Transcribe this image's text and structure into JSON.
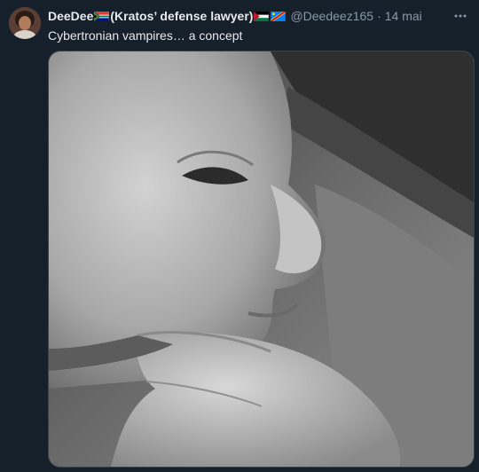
{
  "tweet": {
    "display_name_prefix": "DeeDee",
    "display_name_main": "(Kratos’ defense lawyer)",
    "handle": "@Deedeez165",
    "separator": "·",
    "date": "14 mai",
    "text": "Cybertronian vampires… a concept",
    "more_icon": "ellipsis-icon",
    "avatar_icon": "avatar",
    "flags": [
      "south-africa-flag-icon",
      "palestine-flag-icon",
      "congo-flag-icon"
    ]
  },
  "media": {
    "description_icon": "baby-photo"
  },
  "colors": {
    "background": "#15202b",
    "primary_text": "#e7e9ea",
    "secondary_text": "#8b98a5",
    "border": "#38444d"
  }
}
